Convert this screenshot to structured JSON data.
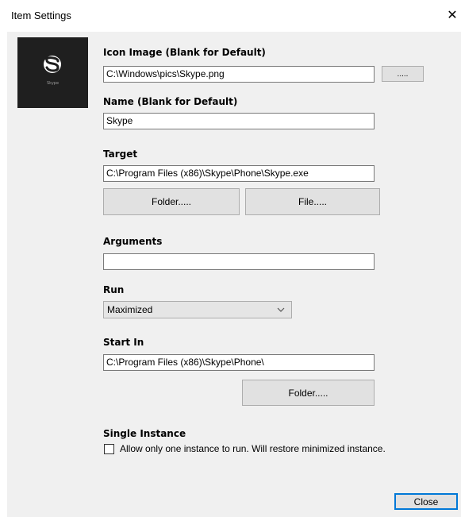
{
  "window": {
    "title": "Item Settings",
    "close_glyph": "✕"
  },
  "preview": {
    "icon": "skype-icon",
    "caption": "Skype"
  },
  "icon_image": {
    "label": "Icon Image (Blank for Default)",
    "value": "C:\\Windows\\pics\\Skype.png",
    "browse_label": "....."
  },
  "name": {
    "label": "Name (Blank for Default)",
    "value": "Skype"
  },
  "target": {
    "label": "Target",
    "value": "C:\\Program Files (x86)\\Skype\\Phone\\Skype.exe",
    "folder_label": "Folder.....",
    "file_label": "File....."
  },
  "arguments": {
    "label": "Arguments",
    "value": ""
  },
  "run": {
    "label": "Run",
    "selected": "Maximized"
  },
  "start_in": {
    "label": "Start In",
    "value": "C:\\Program Files (x86)\\Skype\\Phone\\",
    "folder_label": "Folder....."
  },
  "single_instance": {
    "label": "Single Instance",
    "checkbox_label": "Allow only one instance to run. Will restore minimized instance.",
    "checked": false
  },
  "footer": {
    "close_label": "Close"
  }
}
